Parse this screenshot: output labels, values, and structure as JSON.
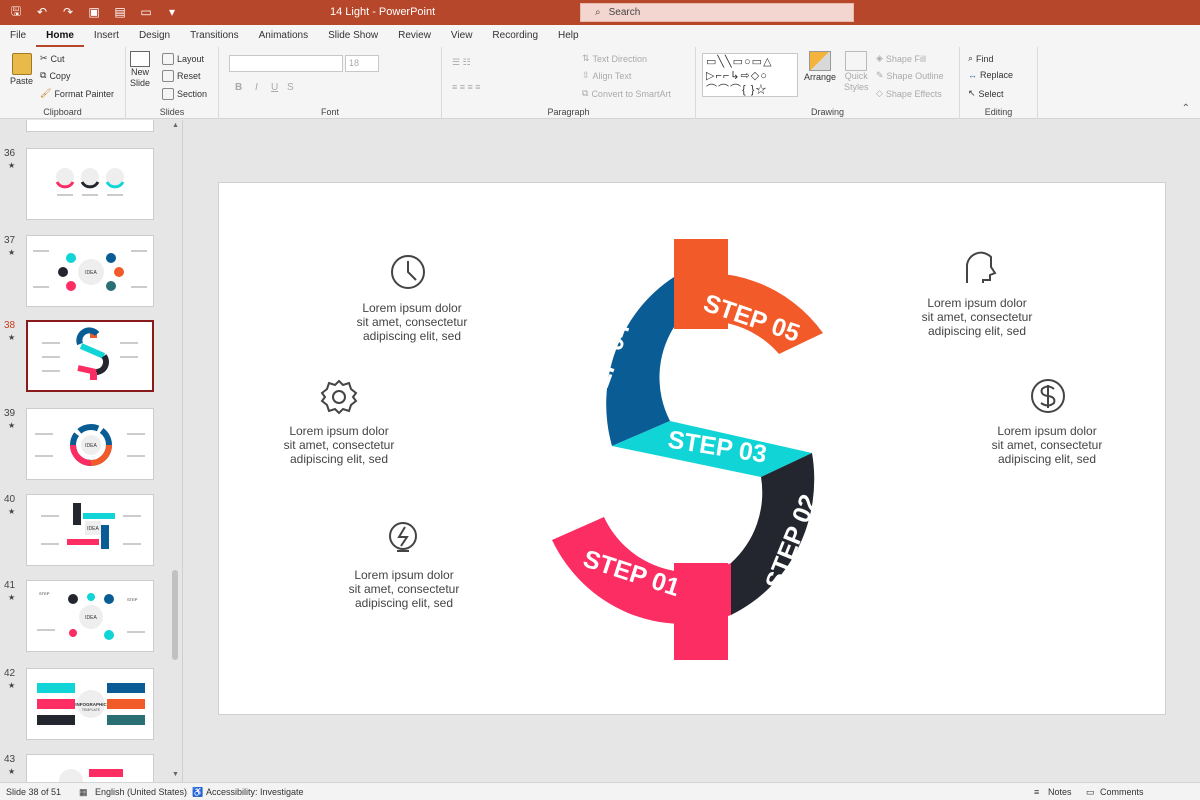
{
  "window": {
    "title": "14 Light  -  PowerPoint",
    "search_placeholder": "Search"
  },
  "menu": {
    "tabs": [
      "File",
      "Home",
      "Insert",
      "Design",
      "Transitions",
      "Animations",
      "Slide Show",
      "Review",
      "View",
      "Recording",
      "Help"
    ],
    "active": "Home"
  },
  "ribbon": {
    "clipboard": {
      "label": "Clipboard",
      "paste": "Paste",
      "cut": "Cut",
      "copy": "Copy",
      "format_painter": "Format Painter"
    },
    "slides": {
      "label": "Slides",
      "new_slide_1": "New",
      "new_slide_2": "Slide",
      "layout": "Layout",
      "reset": "Reset",
      "section": "Section"
    },
    "font": {
      "label": "Font",
      "size": "18",
      "bold": "B",
      "italic": "I",
      "underline": "U",
      "strike": "S"
    },
    "paragraph": {
      "label": "Paragraph",
      "text_direction": "Text Direction",
      "align_text": "Align Text",
      "convert": "Convert to SmartArt"
    },
    "drawing": {
      "label": "Drawing",
      "arrange": "Arrange",
      "quick_1": "Quick",
      "quick_2": "Styles",
      "shape_fill": "Shape Fill",
      "shape_outline": "Shape Outline",
      "shape_effects": "Shape Effects"
    },
    "editing": {
      "label": "Editing",
      "find": "Find",
      "replace": "Replace",
      "select": "Select"
    }
  },
  "thumbnails": [
    {
      "num": "36"
    },
    {
      "num": "37"
    },
    {
      "num": "38"
    },
    {
      "num": "39"
    },
    {
      "num": "40"
    },
    {
      "num": "41"
    },
    {
      "num": "42"
    },
    {
      "num": "43"
    }
  ],
  "thumb_text": {
    "idea": "IDEA",
    "step": "STEP",
    "infographic": "INFOGRAPHIC",
    "template": "TEMPLATE"
  },
  "selected_slide": "38",
  "slide": {
    "steps": [
      "STEP 01",
      "STEP 02",
      "STEP 03",
      "STEP 04",
      "STEP 05"
    ],
    "step_colors": [
      "#fb2d62",
      "#23262f",
      "#11d4d6",
      "#0a5c95",
      "#f25a2a"
    ],
    "lorem": {
      "line1": "Lorem ipsum dolor",
      "line2": "sit amet, consectetur",
      "line3": "adipiscing elit, sed"
    },
    "lorem_alt": {
      "line1": "Lorem ipsum dolor",
      "line2": "sit amet, consectetur",
      "line3": "adipiscing elit, sed"
    },
    "icons": [
      "clock-icon",
      "gear-icon",
      "lightbulb-icon",
      "head-icon",
      "dollar-icon"
    ]
  },
  "status": {
    "slide": "Slide 38 of 51",
    "language": "English (United States)",
    "accessibility": "Accessibility: Investigate",
    "notes": "Notes",
    "comments": "Comments"
  }
}
